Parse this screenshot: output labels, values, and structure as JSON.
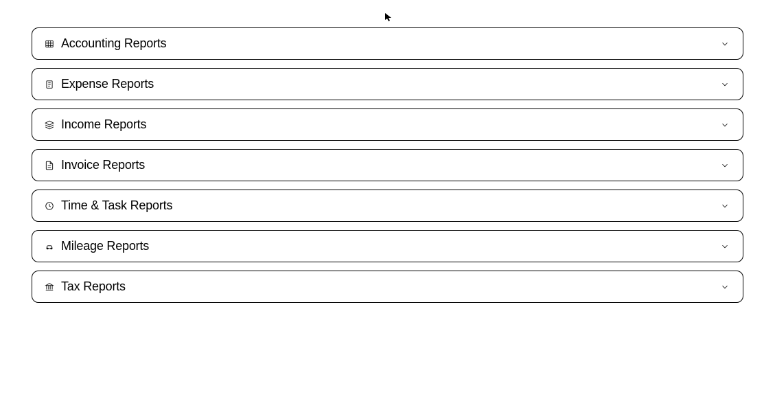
{
  "reports": [
    {
      "label": "Accounting Reports",
      "icon": "table-icon"
    },
    {
      "label": "Expense Reports",
      "icon": "receipt-icon"
    },
    {
      "label": "Income Reports",
      "icon": "stack-icon"
    },
    {
      "label": "Invoice Reports",
      "icon": "file-icon"
    },
    {
      "label": "Time & Task Reports",
      "icon": "clock-icon"
    },
    {
      "label": "Mileage Reports",
      "icon": "car-icon"
    },
    {
      "label": "Tax Reports",
      "icon": "bank-icon"
    }
  ]
}
